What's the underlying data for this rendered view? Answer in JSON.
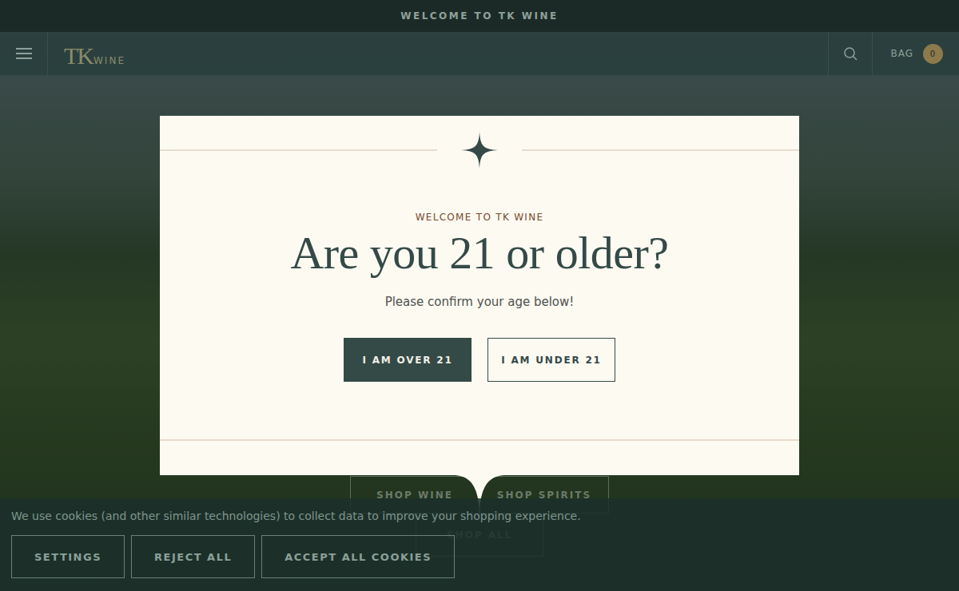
{
  "announcement": "WELCOME TO TK WINE",
  "header": {
    "logo": {
      "mark": "TK",
      "word": "WINE"
    },
    "bag": {
      "label": "BAG",
      "count": "0"
    }
  },
  "hero": {
    "buttons": [
      "SHOP WINE",
      "SHOP SPIRITS",
      "SHOP ALL"
    ]
  },
  "modal": {
    "eyebrow": "WELCOME TO TK WINE",
    "title": "Are you 21 or older?",
    "subtitle": "Please confirm your age below!",
    "buttons": [
      {
        "label": "I AM OVER 21",
        "kind": "primary"
      },
      {
        "label": "I AM UNDER 21",
        "kind": "secondary"
      }
    ]
  },
  "cookies": {
    "message": "We use cookies (and other similar technologies) to collect data to improve your shopping experience.",
    "buttons": [
      "SETTINGS",
      "REJECT ALL",
      "ACCEPT ALL COOKIES"
    ]
  }
}
